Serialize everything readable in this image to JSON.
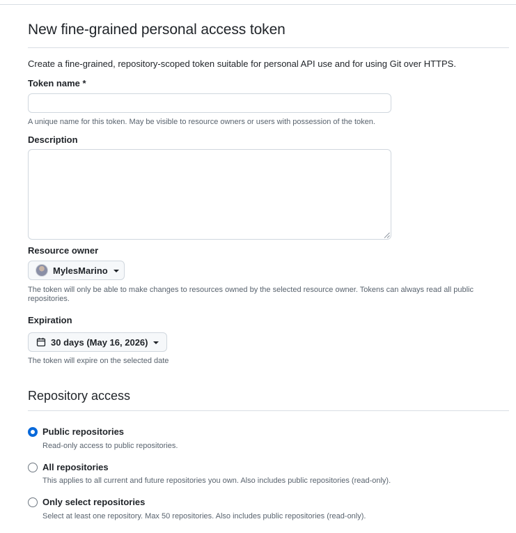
{
  "page": {
    "title": "New fine-grained personal access token",
    "intro": "Create a fine-grained, repository-scoped token suitable for personal API use and for using Git over HTTPS."
  },
  "token_name": {
    "label": "Token name *",
    "value": "",
    "hint": "A unique name for this token. May be visible to resource owners or users with possession of the token."
  },
  "description": {
    "label": "Description",
    "value": ""
  },
  "resource_owner": {
    "label": "Resource owner",
    "selected": "MylesMarino",
    "hint": "The token will only be able to make changes to resources owned by the selected resource owner. Tokens can always read all public repositories."
  },
  "expiration": {
    "label": "Expiration",
    "selected": "30 days (May 16, 2026)",
    "hint": "The token will expire on the selected date"
  },
  "repository_access": {
    "title": "Repository access",
    "options": [
      {
        "label": "Public repositories",
        "description": "Read-only access to public repositories.",
        "checked": true
      },
      {
        "label": "All repositories",
        "description": "This applies to all current and future repositories you own. Also includes public repositories (read-only).",
        "checked": false
      },
      {
        "label": "Only select repositories",
        "description": "Select at least one repository. Max 50 repositories. Also includes public repositories (read-only).",
        "checked": false
      }
    ]
  },
  "colors": {
    "accent": "#0969da",
    "border": "#d0d7de",
    "muted_text": "#59636e",
    "text": "#1f2328",
    "button_bg": "#f6f8fa"
  }
}
